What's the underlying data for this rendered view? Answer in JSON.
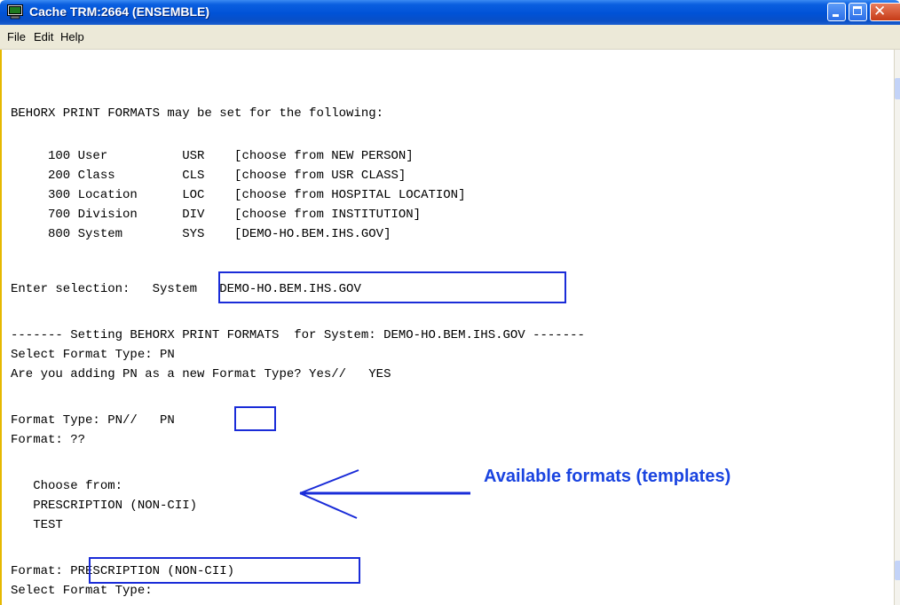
{
  "window": {
    "title": "Cache TRM:2664 (ENSEMBLE)",
    "close_glyph": "✕"
  },
  "menu": {
    "items": [
      "File",
      "Edit",
      "Help"
    ]
  },
  "terminal": {
    "lines": [
      "BEHORX PRINT FORMATS may be set for the following:",
      "     100 User          USR    [choose from NEW PERSON]",
      "     200 Class         CLS    [choose from USR CLASS]",
      "     300 Location      LOC    [choose from HOSPITAL LOCATION]",
      "     700 Division      DIV    [choose from INSTITUTION]",
      "     800 System        SYS    [DEMO-HO.BEM.IHS.GOV]",
      "Enter selection:   System   DEMO-HO.BEM.IHS.GOV",
      "------- Setting BEHORX PRINT FORMATS  for System: DEMO-HO.BEM.IHS.GOV -------",
      "Select Format Type: PN",
      "Are you adding PN as a new Format Type? Yes//   YES",
      "Format Type: PN//   PN",
      "Format: ??",
      "   Choose from:",
      "   PRESCRIPTION (NON-CII)",
      "   TEST",
      "Format: PRESCRIPTION (NON-CII)",
      "Select Format Type:"
    ]
  },
  "annotation": {
    "text": "Available formats (templates)"
  },
  "colors": {
    "highlight": "#1a2cd8",
    "annotation": "#1a44e0",
    "titlebar": "#0052d6"
  }
}
